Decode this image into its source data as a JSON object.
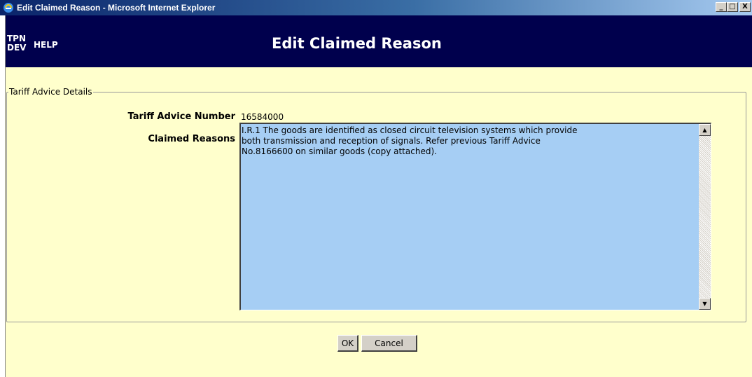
{
  "window": {
    "title": "Edit Claimed Reason - Microsoft Internet Explorer",
    "controls": {
      "minimize": "_",
      "maximize": "□",
      "close": "X"
    }
  },
  "header": {
    "env_label": "TPN\nDEV",
    "help_label": "HELP",
    "page_title": "Edit Claimed Reason"
  },
  "details": {
    "legend": "Tariff Advice Details",
    "tariff_advice_number_label": "Tariff Advice Number",
    "tariff_advice_number_value": "16584000",
    "claimed_reasons_label": "Claimed Reasons",
    "claimed_reasons_value": "I.R.1 The goods are identified as closed circuit television systems which provide\nboth transmission and reception of signals. Refer previous Tariff Advice\nNo.8166600 on similar goods (copy attached)."
  },
  "buttons": {
    "ok_label": "OK",
    "cancel_label": "Cancel"
  },
  "colors": {
    "header_bg": "#00004d",
    "content_bg": "#ffffcc",
    "textarea_bg": "#a6cef4"
  },
  "icons": {
    "app": "internet-explorer-icon",
    "scroll_up": "scroll-up-arrow-icon",
    "scroll_down": "scroll-down-arrow-icon"
  }
}
